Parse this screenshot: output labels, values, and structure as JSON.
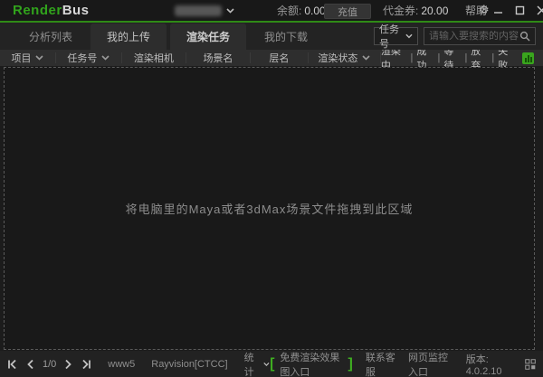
{
  "titlebar": {
    "logo_part1": "Render",
    "logo_part2": "Bus",
    "balance_label": "余额:",
    "balance_value": "0.00",
    "recharge_label": "充值",
    "voucher_label": "代金券:",
    "voucher_value": "20.00",
    "help_label": "帮助"
  },
  "tabs": [
    {
      "label": "分析列表"
    },
    {
      "label": "我的上传"
    },
    {
      "label": "渲染任务"
    },
    {
      "label": "我的下载"
    }
  ],
  "search": {
    "field_selector": "任务号",
    "placeholder": "请输入要搜索的内容"
  },
  "table": {
    "columns": [
      "项目",
      "任务号",
      "渲染相机",
      "场景名",
      "层名",
      "渲染状态"
    ],
    "status_filters": [
      "渲染中",
      "成功",
      "等待",
      "放弃",
      "失败"
    ],
    "filter_separator": "|"
  },
  "drop_area": {
    "hint": "将电脑里的Maya或者3dMax场景文件拖拽到此区域"
  },
  "statusbar": {
    "page_indicator": "1/0",
    "server": "www5",
    "line": "Rayvision[CTCC]",
    "stats_label": "统计",
    "bracket_left": "[",
    "bracket_right": "]",
    "free_render_entry": "免费渲染效果图入口",
    "contact_support": "联系客服",
    "web_monitor": "网页监控入口",
    "version_label": "版本:",
    "version_value": "4.0.2.10"
  },
  "colors": {
    "accent_green": "#2f8a16",
    "logo_green": "#31a31c",
    "chart_button_green": "#3aa51e",
    "background_dark": "#191919"
  }
}
